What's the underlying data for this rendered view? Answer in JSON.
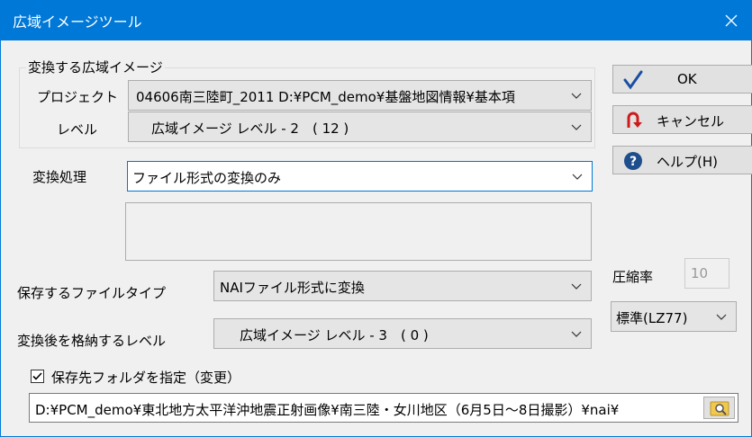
{
  "window": {
    "title": "広域イメージツール"
  },
  "group": {
    "title": "変換する広域イメージ"
  },
  "project": {
    "label": "プロジェクト",
    "value": "04606南三陸町_2011 D:¥PCM_demo¥基盤地図情報¥基本項"
  },
  "level": {
    "label": "レベル",
    "value": "広域イメージ レベル - 2　( 12 )"
  },
  "process": {
    "label": "変換処理",
    "value": "ファイル形式の変換のみ"
  },
  "filetype": {
    "label": "保存するファイルタイプ",
    "value": "NAIファイル形式に変換"
  },
  "target_level": {
    "label": "変換後を格納するレベル",
    "value": "広域イメージ レベル - 3　( 0 )"
  },
  "compression": {
    "label": "圧縮率",
    "value": "10",
    "mode": "標準(LZ77)"
  },
  "save_folder": {
    "checkbox_label": "保存先フォルダを指定（変更）",
    "checked": true,
    "path": "D:¥PCM_demo¥東北地方太平洋沖地震正射画像¥南三陸・女川地区（6月5日～8日撮影）¥nai¥"
  },
  "buttons": {
    "ok": "OK",
    "cancel": "キャンセル",
    "help": "ヘルプ(H)"
  },
  "colors": {
    "titlebar": "#0078d7",
    "background": "#f0f0f0",
    "ok_check": "#1a4fa0",
    "cancel_arrow": "#d01a1a",
    "help_circle": "#1e4f8c"
  }
}
